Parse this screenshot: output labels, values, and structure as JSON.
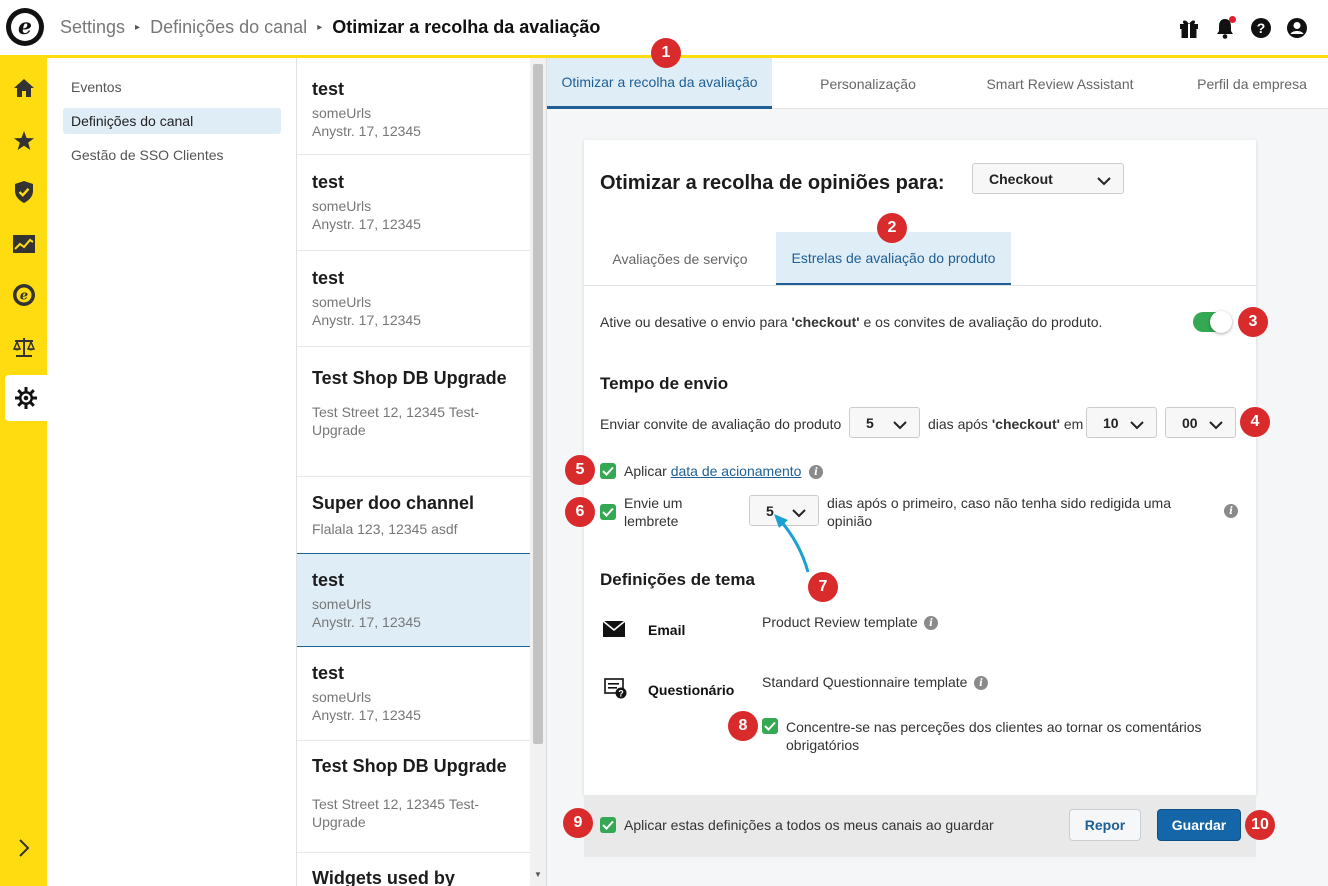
{
  "header": {
    "breadcrumb": [
      "Settings",
      "Definições do canal",
      "Otimizar a recolha da avaliação"
    ],
    "icons": [
      "gift-icon",
      "bell-icon",
      "help-icon",
      "account-icon"
    ]
  },
  "rail": {
    "items": [
      "home-icon",
      "star-icon",
      "shield-icon",
      "chart-icon",
      "trusted-e-icon",
      "scales-icon",
      "gear-icon"
    ],
    "expand": "chevron-right-icon"
  },
  "subnav": {
    "items": [
      {
        "label": "Eventos"
      },
      {
        "label": "Definições do canal"
      },
      {
        "label": "Gestão de SSO Clientes"
      }
    ]
  },
  "channels": [
    {
      "title": "test",
      "line1": "someUrls",
      "line2": "Anystr. 17, 12345"
    },
    {
      "title": "test",
      "line1": "someUrls",
      "line2": "Anystr. 17, 12345"
    },
    {
      "title": "test",
      "line1": "someUrls",
      "line2": "Anystr. 17, 12345"
    },
    {
      "title": "Test Shop DB Upgrade",
      "line1": "Test Street 12, 12345 Test-",
      "line2": "Upgrade"
    },
    {
      "title": "Super doo channel",
      "line1": "Flalala 123, 12345 asdf",
      "line2": ""
    },
    {
      "title": "test",
      "line1": "someUrls",
      "line2": "Anystr. 17, 12345"
    },
    {
      "title": "test",
      "line1": "someUrls",
      "line2": "Anystr. 17, 12345"
    },
    {
      "title": "Test Shop DB Upgrade",
      "line1": "Test Street 12, 12345 Test-",
      "line2": "Upgrade"
    },
    {
      "title": "Widgets used by",
      "line1": "",
      "line2": ""
    }
  ],
  "tabs": [
    "Otimizar a recolha da avaliação",
    "Personalização",
    "Smart Review Assistant",
    "Perfil da empresa"
  ],
  "card": {
    "title": "Otimizar a recolha de opiniões para:",
    "trigger_select": "Checkout",
    "subtabs": [
      "Avaliações de serviço",
      "Estrelas de avaliação do produto"
    ],
    "toggle_text_pre": "Ative ou desative o envio para ",
    "toggle_text_bold": "'checkout'",
    "toggle_text_post": " e os convites de avaliação do produto.",
    "send_time_heading": "Tempo de envio",
    "send_label": "Enviar convite de avaliação do produto",
    "days_value": "5",
    "days_after_pre": "dias após ",
    "days_after_bold": "'checkout'",
    "days_after_post": " em",
    "hour_value": "10",
    "minute_value": "00",
    "apply_label": "Aplicar ",
    "apply_link": "data de acionamento",
    "reminder_label": "Envie um lembrete",
    "reminder_value": "5",
    "reminder_text": "dias após o primeiro, caso não tenha sido redigida uma opinião",
    "theme_heading": "Definições de tema",
    "email_label": "Email",
    "email_template": "Product Review template",
    "questionnaire_label": "Questionário",
    "questionnaire_template": "Standard Questionnaire template",
    "comments_required": "Concentre-se nas perceções dos clientes ao tornar os comentários obrigatórios"
  },
  "footer": {
    "apply_all": "Aplicar estas definições a todos os meus canais ao guardar",
    "reset": "Repor",
    "save": "Guardar"
  },
  "badges": [
    "1",
    "2",
    "3",
    "4",
    "5",
    "6",
    "7",
    "8",
    "9",
    "10"
  ],
  "colors": {
    "brand_yellow": "#ffdc0f",
    "accent_blue": "#1e5f95",
    "active_bg": "#dfedf6",
    "toggle_green": "#34a853",
    "badge_red": "#d92b2b"
  }
}
